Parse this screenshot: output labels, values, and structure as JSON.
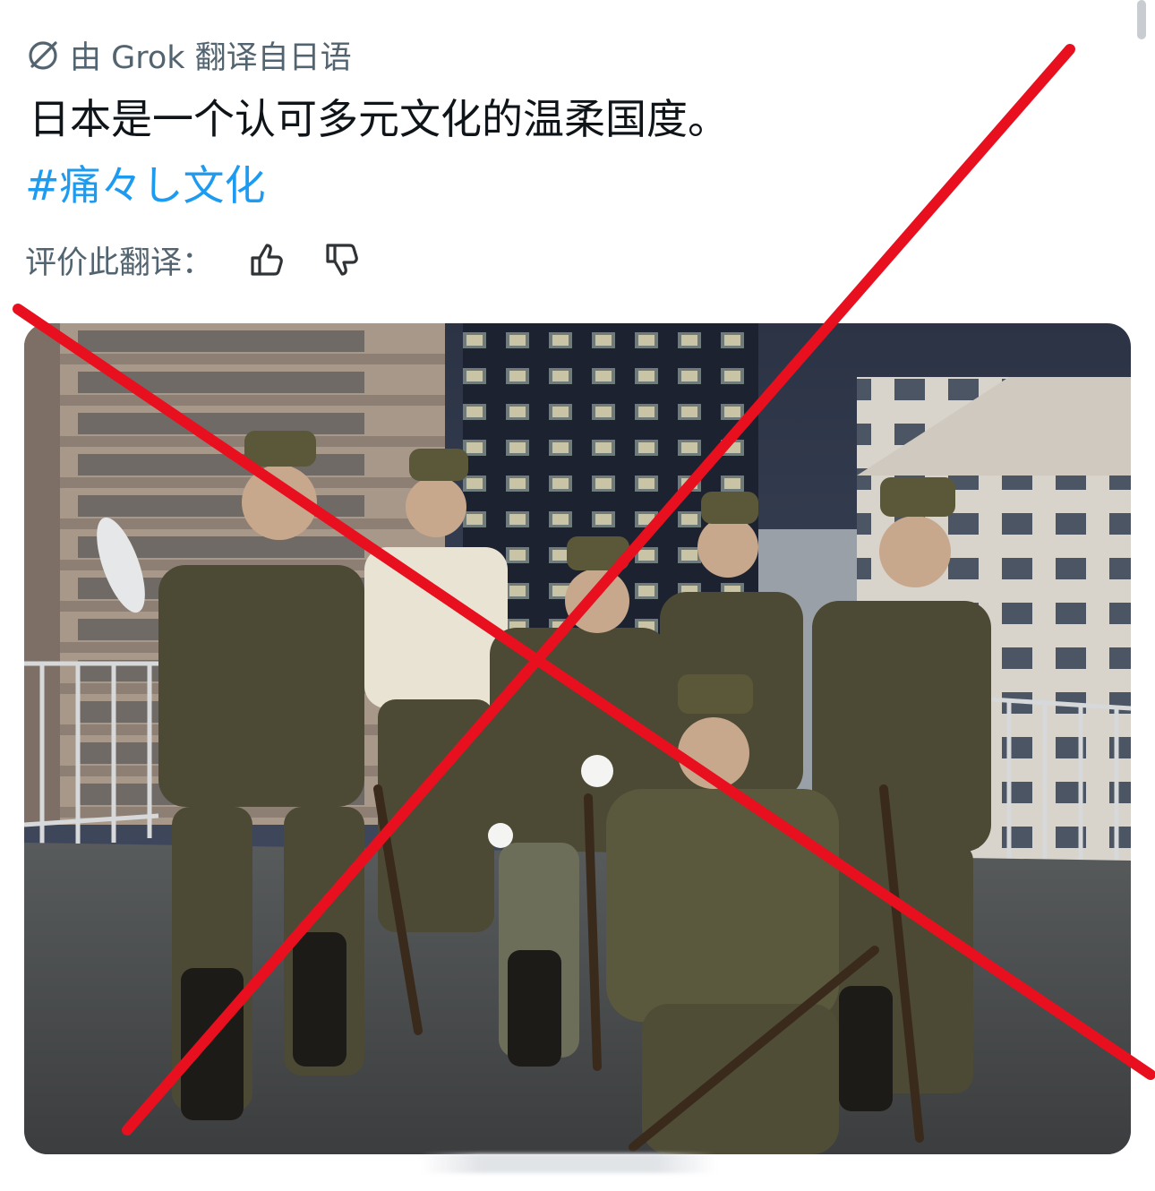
{
  "translation": {
    "label": "由 Grok 翻译自日语",
    "icon": "grok-icon"
  },
  "post": {
    "text": "日本是一个认可多元文化的温柔国度。",
    "hashtag": "#痛々し文化"
  },
  "rating": {
    "label": "评价此翻译：",
    "up_icon": "thumbs-up-icon",
    "down_icon": "thumbs-down-icon"
  },
  "colors": {
    "text_primary": "#0f1419",
    "text_secondary": "#536471",
    "hashtag": "#1d9bf0",
    "cross": "#e8101f"
  },
  "media": {
    "icon": "photo-image"
  }
}
